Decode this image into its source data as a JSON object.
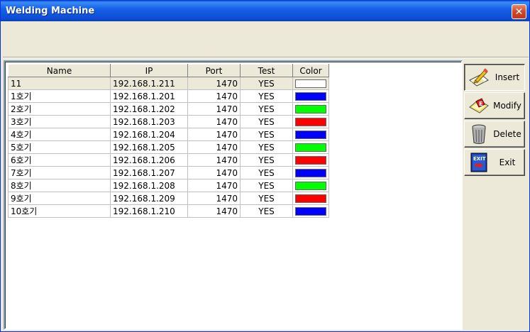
{
  "window": {
    "title": "Welding Machine",
    "close_glyph": "✕"
  },
  "table": {
    "columns": [
      "Name",
      "IP",
      "Port",
      "Test",
      "Color"
    ],
    "rows": [
      {
        "name": "11",
        "ip": "192.168.1.211",
        "port": "1470",
        "test": "YES",
        "color": "#ffffff"
      },
      {
        "name": "1호기",
        "ip": "192.168.1.201",
        "port": "1470",
        "test": "YES",
        "color": "#0000ff"
      },
      {
        "name": "2호기",
        "ip": "192.168.1.202",
        "port": "1470",
        "test": "YES",
        "color": "#00ff00"
      },
      {
        "name": "3호기",
        "ip": "192.168.1.203",
        "port": "1470",
        "test": "YES",
        "color": "#ff0000"
      },
      {
        "name": "4호기",
        "ip": "192.168.1.204",
        "port": "1470",
        "test": "YES",
        "color": "#0000ff"
      },
      {
        "name": "5호기",
        "ip": "192.168.1.205",
        "port": "1470",
        "test": "YES",
        "color": "#00ff00"
      },
      {
        "name": "6호기",
        "ip": "192.168.1.206",
        "port": "1470",
        "test": "YES",
        "color": "#ff0000"
      },
      {
        "name": "7호기",
        "ip": "192.168.1.207",
        "port": "1470",
        "test": "YES",
        "color": "#0000ff"
      },
      {
        "name": "8호기",
        "ip": "192.168.1.208",
        "port": "1470",
        "test": "YES",
        "color": "#00ff00"
      },
      {
        "name": "9호기",
        "ip": "192.168.1.209",
        "port": "1470",
        "test": "YES",
        "color": "#ff0000"
      },
      {
        "name": "10호기",
        "ip": "192.168.1.210",
        "port": "1470",
        "test": "YES",
        "color": "#0000ff"
      }
    ]
  },
  "buttons": {
    "insert": {
      "label": "Insert",
      "icon": "pencil-paper-icon"
    },
    "modify": {
      "label": "Modify",
      "icon": "edit-eraser-icon"
    },
    "delete": {
      "label": "Delete",
      "icon": "trash-can-icon"
    },
    "exit": {
      "label": "Exit",
      "icon": "exit-door-icon",
      "icon_text": "EXIT"
    }
  }
}
